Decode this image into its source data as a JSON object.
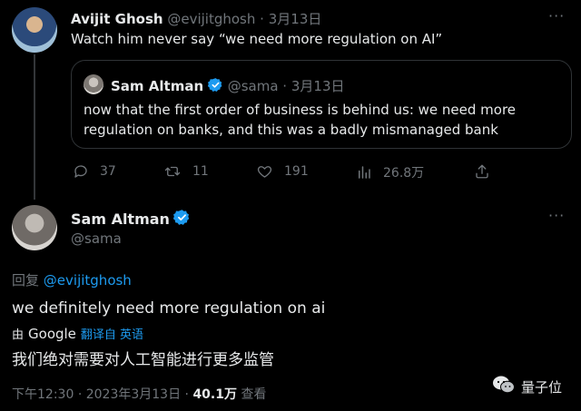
{
  "tweet1": {
    "author_name": "Avijit Ghosh",
    "handle": "@evijitghosh",
    "separator": "·",
    "date": "3月13日",
    "text": "Watch him never say “we need more regulation on AI”"
  },
  "quote": {
    "author_name": "Sam Altman",
    "handle": "@sama",
    "separator": "·",
    "date": "3月13日",
    "text_line1": "now that the first order of business is behind us: we need more",
    "text_line2": "regulation on banks, and this was a badly mismanaged bank"
  },
  "actions": {
    "replies": "37",
    "retweets": "11",
    "likes": "191",
    "views": "26.8万"
  },
  "tweet2": {
    "author_name": "Sam Altman",
    "handle": "@sama",
    "reply_prefix": "回复",
    "reply_to": "@evijitghosh",
    "text": "we definitely need more regulation on ai",
    "translation_by": "由",
    "translation_provider": "Google",
    "translation_action": "翻译自 英语",
    "translated_text": "我们绝对需要对人工智能进行更多监管",
    "time": "下午12:30",
    "separator": "·",
    "date": "2023年3月13日",
    "separator2": "·",
    "views_count": "40.1万",
    "views_label": "查看"
  },
  "watermark": {
    "label": "量子位"
  },
  "colors": {
    "background": "#000000",
    "text": "#e7e9ea",
    "muted": "#71767b",
    "link": "#1d9bf0",
    "verified": "#1d9bf0",
    "border": "#2f3336"
  },
  "icons": [
    "more-icon",
    "verified-icon",
    "reply-icon",
    "retweet-icon",
    "like-icon",
    "views-icon",
    "share-icon",
    "wechat-icon",
    "google-logo"
  ]
}
